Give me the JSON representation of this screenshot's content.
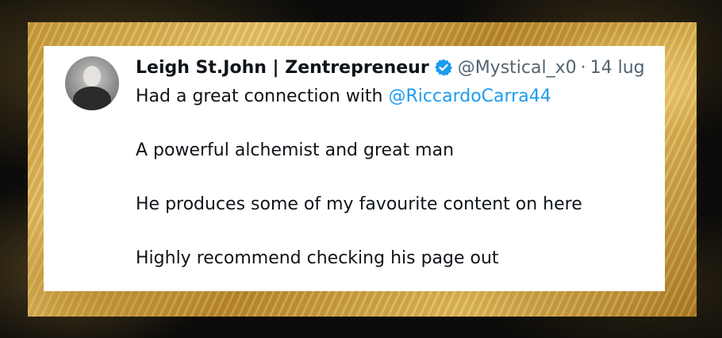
{
  "tweet": {
    "author": {
      "display_name": "Leigh St.John | Zentrepreneur",
      "handle": "@Mystical_x0",
      "separator": "·",
      "date": "14 lug",
      "avatar_icon": "profile-photo",
      "verified_icon": "verified-badge-icon"
    },
    "intro_text": "Had a great connection with",
    "mention": "@RiccardoCarra44",
    "paragraphs": [
      "A powerful alchemist and great man",
      "He produces some of my favourite content on here",
      "Highly recommend checking his page out"
    ]
  },
  "colors": {
    "mention": "#1d9bf0",
    "verified": "#1d9bf0",
    "text": "#0f1419",
    "muted": "#536471",
    "frame": "#d4a94a"
  }
}
